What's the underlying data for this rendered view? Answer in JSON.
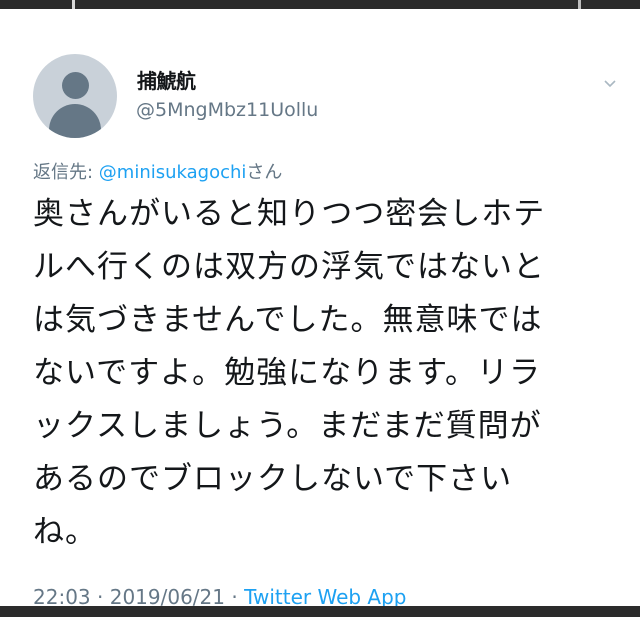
{
  "tweet": {
    "author": {
      "display_name": "捕鯱航",
      "handle": "@5MngMbz11Uollu",
      "avatar_icon": "default-avatar-icon"
    },
    "menu_icon": "chevron-down-icon",
    "reply_to": {
      "prefix": "返信先: ",
      "mention": "@minisukagochi",
      "suffix": "さん"
    },
    "text_lines": [
      "奥さんがいると知りつつ密会しホテ",
      "ルへ行くのは双方の浮気ではないと",
      "は気づきませんでした。無意味では",
      "ないですよ。勉強になります。リラ",
      "ックスしましょう。まだまだ質問が",
      "あるのでブロックしないで下さい",
      "ね。"
    ],
    "time": "22:03",
    "separator": " · ",
    "date": "2019/06/21",
    "source": "Twitter Web App"
  },
  "colors": {
    "text": "#14171a",
    "secondary": "#657786",
    "link": "#1da1f2",
    "avatar_bg": "#c9d1d9"
  }
}
